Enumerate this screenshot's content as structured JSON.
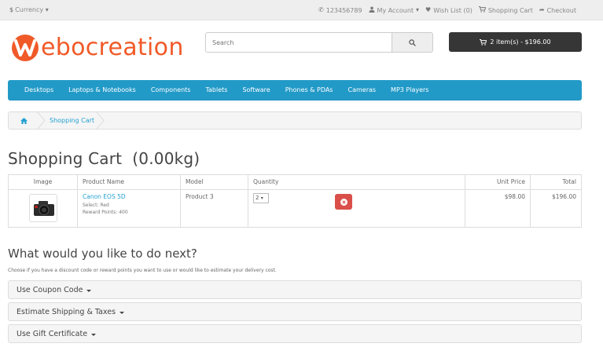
{
  "topbar": {
    "currency_label": "Currency",
    "phone": "123456789",
    "my_account": "My Account",
    "wish_list": "Wish List (0)",
    "shopping_cart": "Shopping Cart",
    "checkout": "Checkout"
  },
  "header": {
    "logo_text": "ebocreation",
    "search_placeholder": "Search",
    "cart_summary": "2 item(s) - $196.00"
  },
  "menu": [
    "Desktops",
    "Laptops & Notebooks",
    "Components",
    "Tablets",
    "Software",
    "Phones & PDAs",
    "Cameras",
    "MP3 Players"
  ],
  "breadcrumb": {
    "current": "Shopping Cart"
  },
  "page": {
    "title": "Shopping Cart  (0.00kg)"
  },
  "cart_table": {
    "headers": [
      "Image",
      "Product Name",
      "Model",
      "Quantity",
      "Unit Price",
      "Total"
    ],
    "rows": [
      {
        "product_name": "Canon EOS 5D",
        "option": "Select: Red",
        "reward": "Reward Points: 400",
        "model": "Product 3",
        "quantity": "2",
        "unit_price": "$98.00",
        "total": "$196.00"
      }
    ]
  },
  "next": {
    "title": "What would you like to do next?",
    "description": "Choose if you have a discount code or reward points you want to use or would like to estimate your delivery cost.",
    "panels": [
      "Use Coupon Code",
      "Estimate Shipping & Taxes",
      "Use Gift Certificate"
    ]
  },
  "colors": {
    "brand_orange": "#f05a28",
    "menu_blue": "#229ac8",
    "link_blue": "#23a1d1",
    "remove_red": "#da4f49",
    "cart_button_dark": "#363636"
  }
}
